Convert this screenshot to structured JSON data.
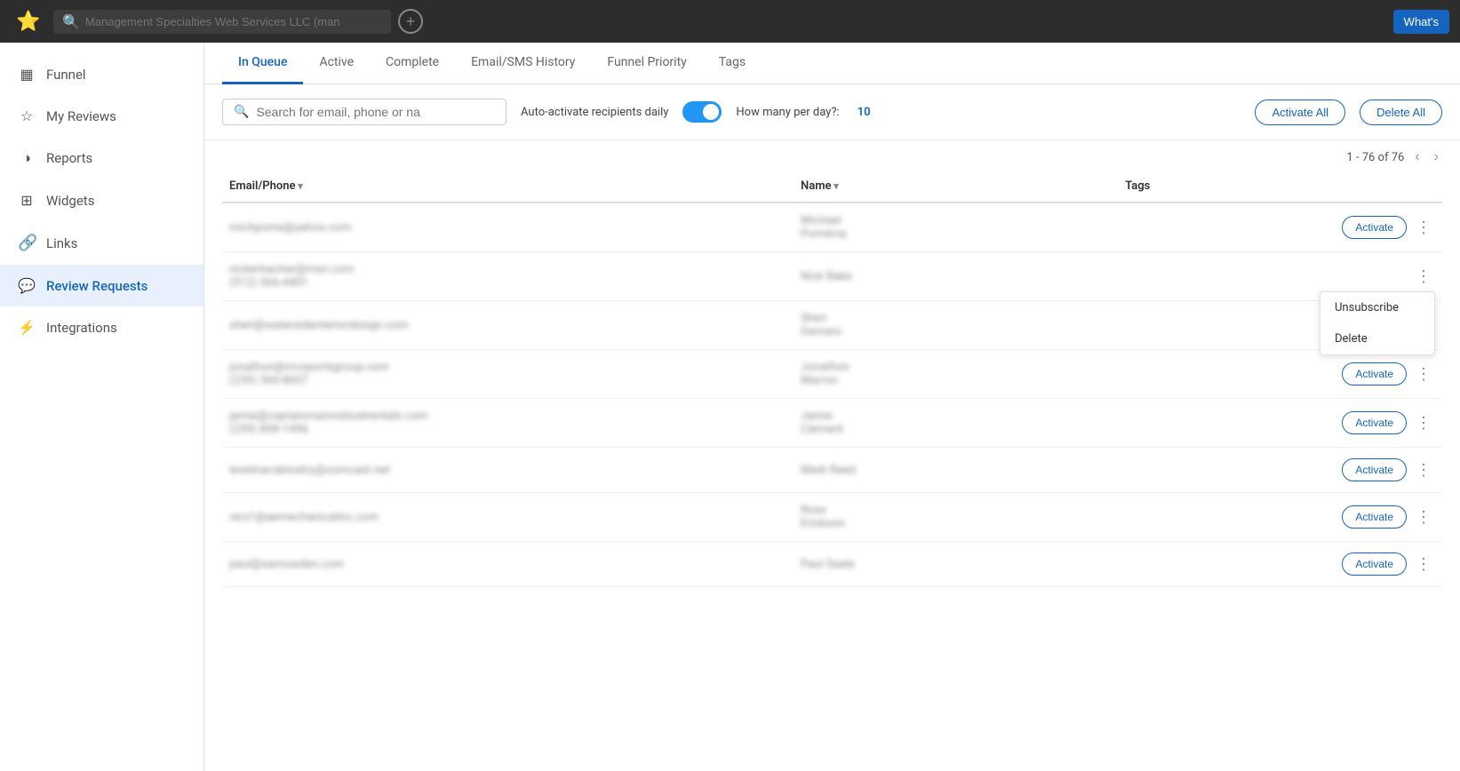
{
  "topbar": {
    "search_placeholder": "Management Specialties Web Services LLC (man",
    "whats_label": "What's"
  },
  "sidebar": {
    "items": [
      {
        "id": "funnel",
        "label": "Funnel",
        "icon": "▦"
      },
      {
        "id": "my-reviews",
        "label": "My Reviews",
        "icon": "☆"
      },
      {
        "id": "reports",
        "label": "Reports",
        "icon": "◑"
      },
      {
        "id": "widgets",
        "label": "Widgets",
        "icon": "⊞"
      },
      {
        "id": "links",
        "label": "Links",
        "icon": "⌁"
      },
      {
        "id": "review-requests",
        "label": "Review Requests",
        "icon": "💬"
      },
      {
        "id": "integrations",
        "label": "Integrations",
        "icon": "⑁"
      }
    ]
  },
  "tabs": [
    {
      "id": "in-queue",
      "label": "In Queue",
      "active": true
    },
    {
      "id": "active",
      "label": "Active"
    },
    {
      "id": "complete",
      "label": "Complete"
    },
    {
      "id": "email-sms-history",
      "label": "Email/SMS History"
    },
    {
      "id": "funnel-priority",
      "label": "Funnel Priority"
    },
    {
      "id": "tags",
      "label": "Tags"
    }
  ],
  "toolbar": {
    "search_placeholder": "Search for email, phone or na",
    "auto_activate_label": "Auto-activate recipients daily",
    "how_many_label": "How many per day?:",
    "how_many_value": "10",
    "activate_all_label": "Activate All",
    "delete_all_label": "Delete All"
  },
  "pagination": {
    "text": "1 - 76 of 76"
  },
  "table": {
    "columns": [
      {
        "id": "email-phone",
        "label": "Email/Phone",
        "sortable": true
      },
      {
        "id": "name",
        "label": "Name",
        "sortable": true
      },
      {
        "id": "tags",
        "label": "Tags",
        "sortable": false
      }
    ],
    "rows": [
      {
        "email": "michpome@yahoo.com",
        "phone": "",
        "name": "Michael\nPomeroy",
        "tags": "",
        "show_dropdown": false
      },
      {
        "email": "nickerbacher@msn.com",
        "phone": "(512) 366-4401",
        "name": "Nick Bake",
        "tags": "",
        "show_dropdown": true
      },
      {
        "email": "sheri@watersidenteriordesign.com",
        "phone": "",
        "name": "Sheri\nGemaro",
        "tags": "",
        "show_dropdown": false
      },
      {
        "email": "jonathon@mvsportsgroup.com",
        "phone": "(239) 360-8607",
        "name": "Jonathon\nMarron",
        "tags": "",
        "show_dropdown": false
      },
      {
        "email": "jamie@captainmannisboatrentals.com",
        "phone": "(239) 898-1496",
        "name": "Jamie\nClement",
        "tags": "",
        "show_dropdown": false
      },
      {
        "email": "levelinecabinetry@comcast.net",
        "phone": "",
        "name": "Mark Reed",
        "tags": "",
        "show_dropdown": false
      },
      {
        "email": "rars1@aemechanicalinc.com",
        "phone": "",
        "name": "Ross\nErickson",
        "tags": "",
        "show_dropdown": false
      },
      {
        "email": "paul@samowden.com",
        "phone": "",
        "name": "Paul Saale",
        "tags": "",
        "show_dropdown": false
      }
    ],
    "dropdown_menu": {
      "items": [
        {
          "id": "unsubscribe",
          "label": "Unsubscribe"
        },
        {
          "id": "delete",
          "label": "Delete"
        }
      ]
    }
  },
  "logo": {
    "stars": "⭐⭐⭐",
    "text": "★★★"
  }
}
